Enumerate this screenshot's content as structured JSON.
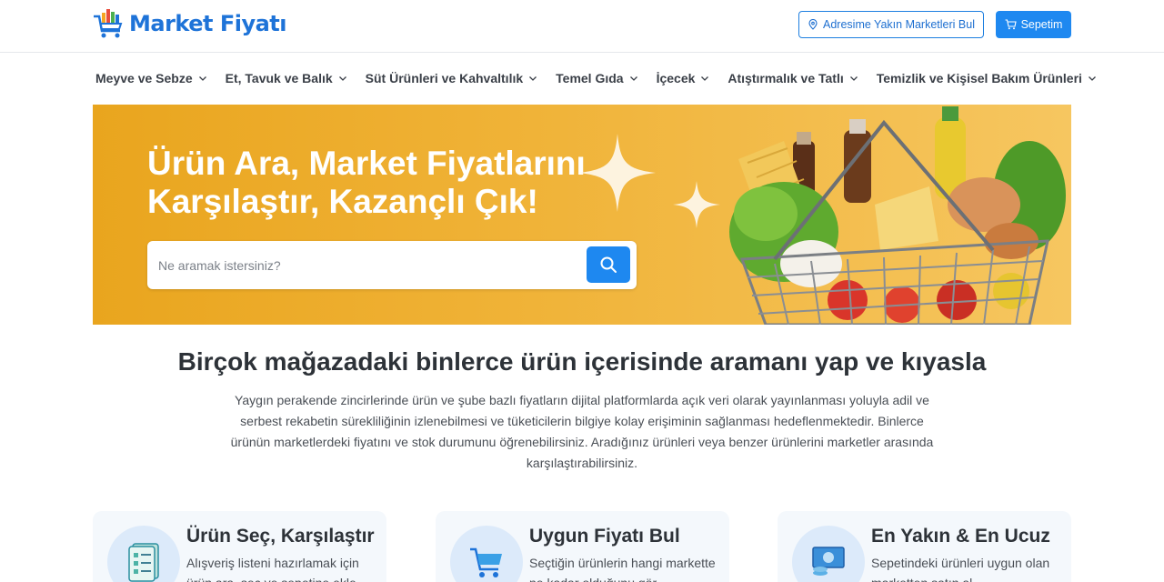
{
  "header": {
    "logo_text": "Market Fiyatı",
    "address_button": "Adresime Yakın Marketleri Bul",
    "cart_button": "Sepetim"
  },
  "nav": {
    "items": [
      {
        "label": "Meyve ve Sebze"
      },
      {
        "label": "Et, Tavuk ve Balık"
      },
      {
        "label": "Süt Ürünleri ve Kahvaltılık"
      },
      {
        "label": "Temel Gıda"
      },
      {
        "label": "İçecek"
      },
      {
        "label": "Atıştırmalık ve Tatlı"
      },
      {
        "label": "Temizlik ve Kişisel Bakım Ürünleri"
      }
    ]
  },
  "hero": {
    "title_line1": "Ürün Ara, Market Fiyatlarını",
    "title_line2": "Karşılaştır, Kazançlı Çık!",
    "search_placeholder": "Ne aramak istersiniz?",
    "search_value": ""
  },
  "section": {
    "title": "Birçok mağazadaki binlerce ürün içerisinde aramanı yap ve kıyasla",
    "description": "Yaygın perakende zincirlerinde ürün ve şube bazlı fiyatların dijital platformlarda açık veri olarak yayınlanması yoluyla adil ve serbest rekabetin sürekliliğinin izlenebilmesi ve tüketicilerin bilgiye kolay erişiminin sağlanması hedeflenmektedir. Binlerce ürünün marketlerdeki fiyatını ve stok durumunu öğrenebilirsiniz. Aradığınız ürünleri veya benzer ürünlerini marketler arasında karşılaştırabilirsiniz."
  },
  "cards": [
    {
      "title": "Ürün Seç, Karşılaştır",
      "text": "Alışveriş listeni hazırlamak için ürün ara, seç ve sepetine ekle.",
      "icon": "checklist-icon"
    },
    {
      "title": "Uygun Fiyatı Bul",
      "text": "Seçtiğin ürünlerin hangi markette ne kadar olduğunu gör.",
      "icon": "cart-icon"
    },
    {
      "title": "En Yakın & En Ucuz",
      "text": "Sepetindeki ürünleri uygun olan marketten satın al.",
      "icon": "money-icon"
    }
  ],
  "colors": {
    "brand_blue": "#1e88f0",
    "hero_orange": "#eea92a",
    "heading": "#2d3238"
  }
}
